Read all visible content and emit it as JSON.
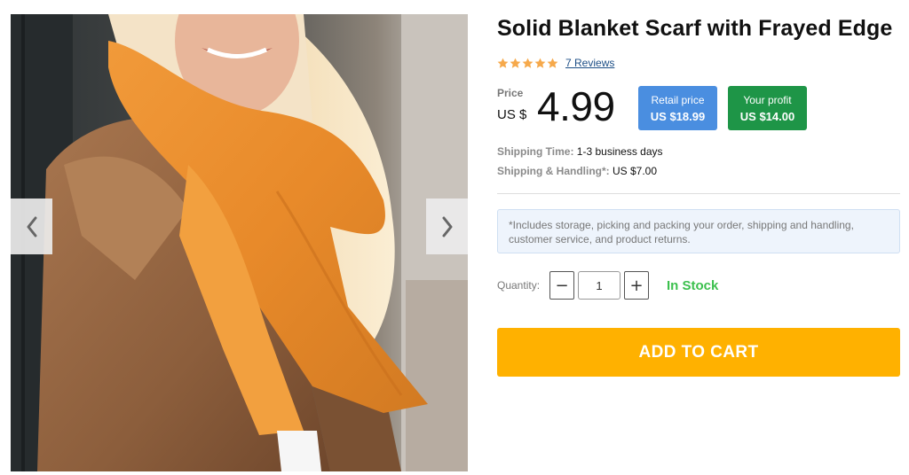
{
  "product": {
    "title": "Solid Blanket Scarf with Frayed Edge",
    "rating": {
      "stars": 5,
      "reviews_label": "7 Reviews"
    },
    "price": {
      "label": "Price",
      "currency": "US $",
      "value": "4.99"
    },
    "retail": {
      "label": "Retail price",
      "amount": "US $18.99"
    },
    "profit": {
      "label": "Your profit",
      "amount": "US $14.00"
    },
    "shipping_time": {
      "label": "Shipping Time:",
      "value": "1-3 business days"
    },
    "shipping_handling": {
      "label": "Shipping & Handling*:",
      "value": "US $7.00"
    },
    "note": "*Includes storage, picking and packing your order, shipping and handling, customer service, and product returns.",
    "quantity": {
      "label": "Quantity:",
      "value": "1",
      "minus": "−",
      "plus": "+"
    },
    "stock": "In Stock",
    "cart_button": "ADD TO CART"
  },
  "gallery": {
    "prev_icon": "chevron-left-icon",
    "next_icon": "chevron-right-icon"
  },
  "colors": {
    "star": "#f6a94b",
    "retail_badge": "#4a8ee0",
    "profit_badge": "#1e9547",
    "in_stock": "#3cc04e",
    "cart_button": "#ffb100",
    "note_bg": "#eef4fc"
  }
}
